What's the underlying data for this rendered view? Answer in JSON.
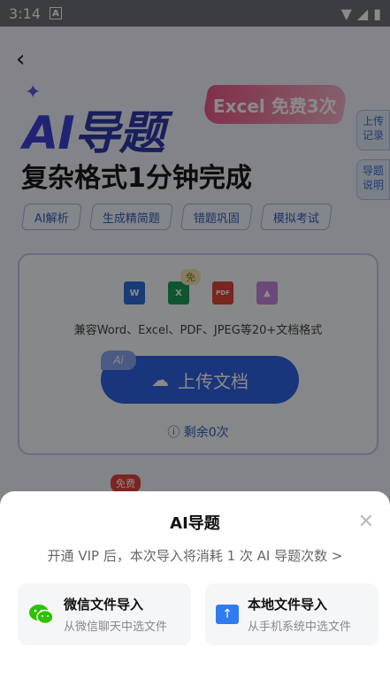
{
  "status": {
    "time": "3:14",
    "a_icon": "A"
  },
  "header": {
    "back_icon": "‹"
  },
  "hero": {
    "title_ai": "AI",
    "title_rest": "导题",
    "promo": "Excel 免费3次",
    "subtitle": "复杂格式1分钟完成"
  },
  "side_tabs": [
    "上传记录",
    "导题说明"
  ],
  "tags": [
    "AI解析",
    "生成精简题",
    "错题巩固",
    "模拟考试"
  ],
  "upload": {
    "free_bubble": "免",
    "file_icons": [
      {
        "label": "W",
        "color": "#2f6fe0"
      },
      {
        "label": "X",
        "color": "#1f9e57"
      },
      {
        "label": "PDF",
        "color": "#e0453b"
      },
      {
        "label": "",
        "color": "#c58ae0"
      }
    ],
    "compat_text": "兼容Word、Excel、PDF、JPEG等20+文档格式",
    "ai_badge": "Ai",
    "button_label": "上传文档",
    "remain_text": "剩余0次"
  },
  "free_tag": "免费",
  "sheet": {
    "title": "AI导题",
    "notice": "开通 VIP 后，本次导入将消耗 1 次 AI 导题次数 >",
    "options": [
      {
        "title": "微信文件导入",
        "desc": "从微信聊天中选文件"
      },
      {
        "title": "本地文件导入",
        "desc": "从手机系统中选文件"
      }
    ]
  }
}
